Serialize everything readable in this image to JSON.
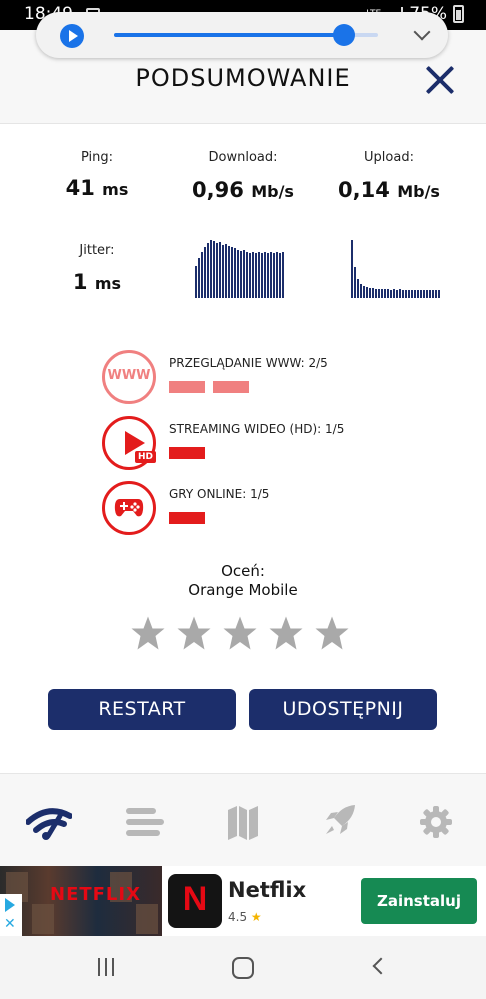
{
  "statusbar": {
    "time": "18:49",
    "network": "LTE",
    "battery": "75%"
  },
  "media": {
    "progress": 0.87
  },
  "header": {
    "title": "PODSUMOWANIE"
  },
  "metrics": {
    "ping": {
      "label": "Ping:",
      "value": "41",
      "unit": "ms"
    },
    "download": {
      "label": "Download:",
      "value": "0,96",
      "unit": "Mb/s"
    },
    "upload": {
      "label": "Upload:",
      "value": "0,14",
      "unit": "Mb/s"
    },
    "jitter": {
      "label": "Jitter:",
      "value": "1",
      "unit": "ms"
    }
  },
  "graphs": {
    "download": [
      30,
      38,
      44,
      48,
      52,
      55,
      54,
      52,
      53,
      50,
      51,
      49,
      48,
      47,
      46,
      45,
      46,
      44,
      43,
      44,
      43,
      44,
      43,
      44,
      43,
      44,
      43,
      44,
      43,
      44
    ],
    "upload": [
      56,
      30,
      18,
      14,
      12,
      11,
      10,
      10,
      9,
      9,
      9,
      9,
      9,
      8,
      9,
      8,
      9,
      8,
      8,
      8,
      8,
      8,
      8,
      8,
      8,
      8,
      8,
      8,
      8,
      8
    ]
  },
  "quality": [
    {
      "icon": "www-icon",
      "icon_text": "WWW",
      "label": "PRZEGLĄDANIE WWW: 2/5",
      "score": 2,
      "color": "#f08080"
    },
    {
      "icon": "video-play-icon",
      "badge": "HD",
      "label": "STREAMING WIDEO (HD): 1/5",
      "score": 1,
      "color": "#e31c1c"
    },
    {
      "icon": "gamepad-icon",
      "label": "GRY ONLINE: 1/5",
      "score": 1,
      "color": "#e31c1c"
    }
  ],
  "rating": {
    "label": "Oceń:",
    "operator": "Orange Mobile",
    "stars": 5
  },
  "buttons": {
    "restart": "RESTART",
    "share": "UDOSTĘPNIJ"
  },
  "nav": [
    {
      "name": "speedtest-icon",
      "active": true
    },
    {
      "name": "history-list-icon",
      "active": false
    },
    {
      "name": "map-icon",
      "active": false
    },
    {
      "name": "rocket-icon",
      "active": false
    },
    {
      "name": "gear-icon",
      "active": false
    }
  ],
  "ad": {
    "thumb_text": "NETFLIX",
    "logo_letter": "N",
    "app_name": "Netflix",
    "rating": "4.5",
    "install_label": "Zainstaluj"
  },
  "colors": {
    "navy": "#1c2e6b",
    "red": "#e31c1c",
    "salmon": "#f08080",
    "green": "#168a53"
  }
}
